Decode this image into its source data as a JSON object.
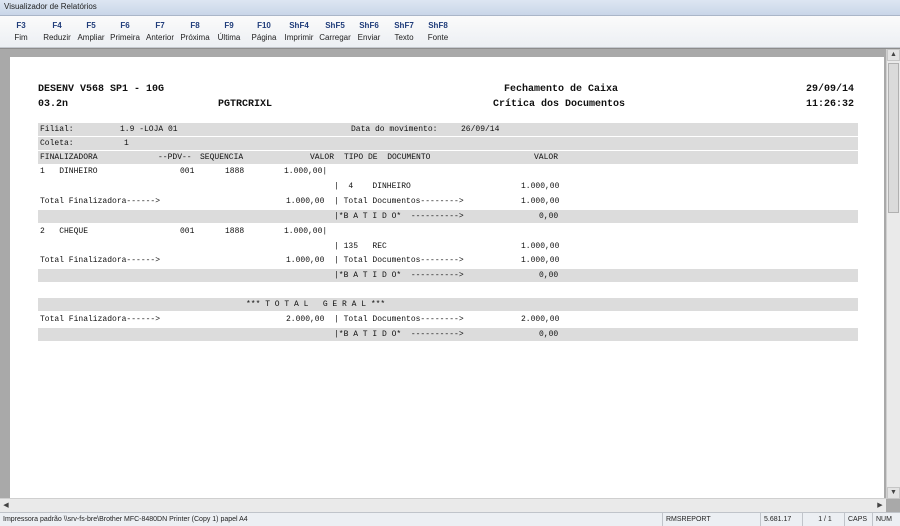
{
  "window": {
    "title": "Visualizador de Relatórios"
  },
  "toolbar": {
    "buttons": [
      {
        "key": "F3",
        "label": "Fim"
      },
      {
        "key": "F4",
        "label": "Reduzir"
      },
      {
        "key": "F5",
        "label": "Ampliar"
      },
      {
        "key": "F6",
        "label": "Primeira"
      },
      {
        "key": "F7",
        "label": "Anterior"
      },
      {
        "key": "F8",
        "label": "Próxima"
      },
      {
        "key": "F9",
        "label": "Última"
      },
      {
        "key": "F10",
        "label": "Página"
      },
      {
        "key": "ShF4",
        "label": "Imprimir"
      },
      {
        "key": "ShF5",
        "label": "Carregar"
      },
      {
        "key": "ShF6",
        "label": "Enviar"
      },
      {
        "key": "ShF7",
        "label": "Texto"
      },
      {
        "key": "ShF8",
        "label": "Fonte"
      }
    ]
  },
  "report": {
    "header": {
      "system": "DESENV V568 SP1 - 10G",
      "version": "03.2n",
      "program": "PGTRCRIXL",
      "title": "Fechamento de Caixa",
      "subtitle": "Crítica dos Documentos",
      "date": "29/09/14",
      "time": "11:26:32"
    },
    "filial_label": "Filial:",
    "filial_value": "1.9 -LOJA 01",
    "movimento_label": "Data do movimento:",
    "movimento_value": "26/09/14",
    "coleta_label": "Coleta:",
    "coleta_value": "1",
    "columns": {
      "finalizadora": "FINALIZADORA",
      "pdv": "--PDV--",
      "sequencia": "SEQUENCIA",
      "valor": "VALOR",
      "tipo_documento": "TIPO DE  DOCUMENTO",
      "valor2": "VALOR"
    },
    "groups": [
      {
        "finalizadora": "1   DINHEIRO",
        "pdv": "001",
        "sequencia": "1888",
        "valor": "1.000,00|",
        "documento": "|  4    DINHEIRO",
        "doc_valor": "1.000,00",
        "total_label": "Total Finalizadora------>",
        "total_valor": "1.000,00",
        "total_docs_label": "| Total Documentos-------->",
        "total_docs_valor": "1.000,00",
        "batido_label": "|*B A T I D O*  ---------->",
        "batido_valor": "0,00"
      },
      {
        "finalizadora": "2   CHEQUE",
        "pdv": "001",
        "sequencia": "1888",
        "valor": "1.000,00|",
        "documento": "| 135   REC",
        "doc_valor": "1.000,00",
        "total_label": "Total Finalizadora------>",
        "total_valor": "1.000,00",
        "total_docs_label": "| Total Documentos-------->",
        "total_docs_valor": "1.000,00",
        "batido_label": "|*B A T I D O*  ---------->",
        "batido_valor": "0,00"
      }
    ],
    "geral": {
      "title": "*** T O T A L   G E R A L ***",
      "total_label": "Total Finalizadora------>",
      "total_valor": "2.000,00",
      "total_docs_label": "| Total Documentos-------->",
      "total_docs_valor": "2.000,00",
      "batido_label": "|*B A T I D O*  ---------->",
      "batido_valor": "0,00"
    }
  },
  "status": {
    "printer": "Impressora padrão \\\\srv-fs-bre\\Brother MFC-8480DN Printer (Copy 1) papel A4",
    "report_name": "RMSREPORT",
    "version": "5.681.17",
    "pages": "1 / 1",
    "caps": "CAPS",
    "num": "NUM"
  }
}
